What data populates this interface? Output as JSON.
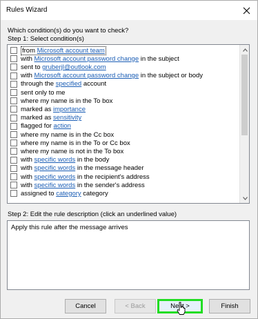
{
  "window": {
    "title": "Rules Wizard"
  },
  "prompt": "Which condition(s) do you want to check?",
  "step1_label": "Step 1: Select condition(s)",
  "conditions": [
    {
      "segments": [
        {
          "t": "from ",
          "link": false
        },
        {
          "t": "Microsoft account team",
          "link": true
        }
      ],
      "checked": false,
      "selected": true
    },
    {
      "segments": [
        {
          "t": "with ",
          "link": false
        },
        {
          "t": "Microsoft account password change",
          "link": true
        },
        {
          "t": " in the subject",
          "link": false
        }
      ],
      "checked": false,
      "selected": false
    },
    {
      "segments": [
        {
          "t": "sent to ",
          "link": false
        },
        {
          "t": "gruberjl@outlook.com",
          "link": true
        }
      ],
      "checked": false,
      "selected": false
    },
    {
      "segments": [
        {
          "t": "with ",
          "link": false
        },
        {
          "t": "Microsoft account password change",
          "link": true
        },
        {
          "t": " in the subject or body",
          "link": false
        }
      ],
      "checked": false,
      "selected": false
    },
    {
      "segments": [
        {
          "t": "through the ",
          "link": false
        },
        {
          "t": "specified",
          "link": true
        },
        {
          "t": " account",
          "link": false
        }
      ],
      "checked": false,
      "selected": false
    },
    {
      "segments": [
        {
          "t": "sent only to me",
          "link": false
        }
      ],
      "checked": false,
      "selected": false
    },
    {
      "segments": [
        {
          "t": "where my name is in the To box",
          "link": false
        }
      ],
      "checked": false,
      "selected": false
    },
    {
      "segments": [
        {
          "t": "marked as ",
          "link": false
        },
        {
          "t": "importance",
          "link": true
        }
      ],
      "checked": false,
      "selected": false
    },
    {
      "segments": [
        {
          "t": "marked as ",
          "link": false
        },
        {
          "t": "sensitivity",
          "link": true
        }
      ],
      "checked": false,
      "selected": false
    },
    {
      "segments": [
        {
          "t": "flagged for ",
          "link": false
        },
        {
          "t": "action",
          "link": true
        }
      ],
      "checked": false,
      "selected": false
    },
    {
      "segments": [
        {
          "t": "where my name is in the Cc box",
          "link": false
        }
      ],
      "checked": false,
      "selected": false
    },
    {
      "segments": [
        {
          "t": "where my name is in the To or Cc box",
          "link": false
        }
      ],
      "checked": false,
      "selected": false
    },
    {
      "segments": [
        {
          "t": "where my name is not in the To box",
          "link": false
        }
      ],
      "checked": false,
      "selected": false
    },
    {
      "segments": [
        {
          "t": "with ",
          "link": false
        },
        {
          "t": "specific words",
          "link": true
        },
        {
          "t": " in the body",
          "link": false
        }
      ],
      "checked": false,
      "selected": false
    },
    {
      "segments": [
        {
          "t": "with ",
          "link": false
        },
        {
          "t": "specific words",
          "link": true
        },
        {
          "t": " in the message header",
          "link": false
        }
      ],
      "checked": false,
      "selected": false
    },
    {
      "segments": [
        {
          "t": "with ",
          "link": false
        },
        {
          "t": "specific words",
          "link": true
        },
        {
          "t": " in the recipient's address",
          "link": false
        }
      ],
      "checked": false,
      "selected": false
    },
    {
      "segments": [
        {
          "t": "with ",
          "link": false
        },
        {
          "t": "specific words",
          "link": true
        },
        {
          "t": " in the sender's address",
          "link": false
        }
      ],
      "checked": false,
      "selected": false
    },
    {
      "segments": [
        {
          "t": "assigned to ",
          "link": false
        },
        {
          "t": "category",
          "link": true
        },
        {
          "t": " category",
          "link": false
        }
      ],
      "checked": false,
      "selected": false
    }
  ],
  "list_scroll": {
    "position": 0.0,
    "visible_fraction": 0.58
  },
  "step2_label": "Step 2: Edit the rule description (click an underlined value)",
  "description_text": "Apply this rule after the message arrives",
  "buttons": {
    "cancel": "Cancel",
    "back": "< Back",
    "next": "Next >",
    "finish": "Finish"
  },
  "colors": {
    "link": "#1a5db5",
    "highlight": "#22dd22",
    "dialog_bg": "#f0f0f0"
  }
}
